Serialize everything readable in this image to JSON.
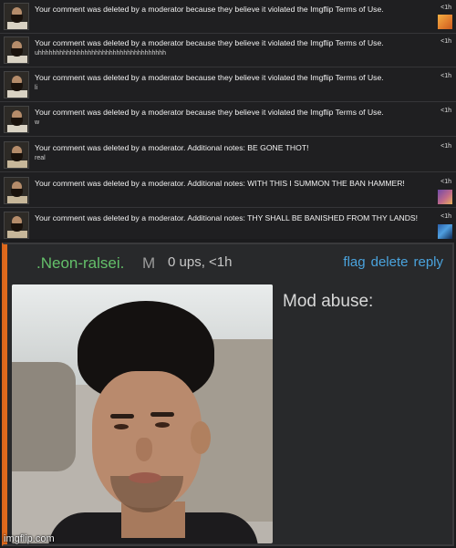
{
  "notifications": [
    {
      "message": "Your comment was deleted by a moderator because they believe it violated the Imgflip Terms of Use.",
      "note": "",
      "time": "<1h",
      "thumb": "orange"
    },
    {
      "message": "Your comment was deleted by a moderator because they believe it violated the Imgflip Terms of Use.",
      "note": "uhhhhhhhhhhhhhhhhhhhhhhhhhhhhhhhhhhhh",
      "time": "<1h",
      "thumb": ""
    },
    {
      "message": "Your comment was deleted by a moderator because they believe it violated the Imgflip Terms of Use.",
      "note": "li",
      "time": "<1h",
      "thumb": ""
    },
    {
      "message": "Your comment was deleted by a moderator because they believe it violated the Imgflip Terms of Use.",
      "note": "w",
      "time": "<1h",
      "thumb": ""
    },
    {
      "message": "Your comment was deleted by a moderator. Additional notes: BE GONE THOT!",
      "note": "real",
      "time": "<1h",
      "thumb": ""
    },
    {
      "message": "Your comment was deleted by a moderator. Additional notes: WITH THIS I SUMMON THE BAN HAMMER!",
      "note": "",
      "time": "<1h",
      "thumb": "purple"
    },
    {
      "message": "Your comment was deleted by a moderator. Additional notes: THY SHALL BE BANISHED FROM THY LANDS!",
      "note": "",
      "time": "<1h",
      "thumb": "blue"
    }
  ],
  "comment": {
    "username": ".Neon-ralsei.",
    "gender": "M",
    "meta": "0 ups, <1h",
    "actions": {
      "flag": "flag",
      "delete": "delete",
      "reply": "reply"
    },
    "text": "Mod abuse:"
  },
  "watermark": "imgflip.com",
  "colors": {
    "username": "#64c06a",
    "link": "#4aa3dd",
    "accent": "#e06a1c",
    "background": "#1f1f21"
  }
}
